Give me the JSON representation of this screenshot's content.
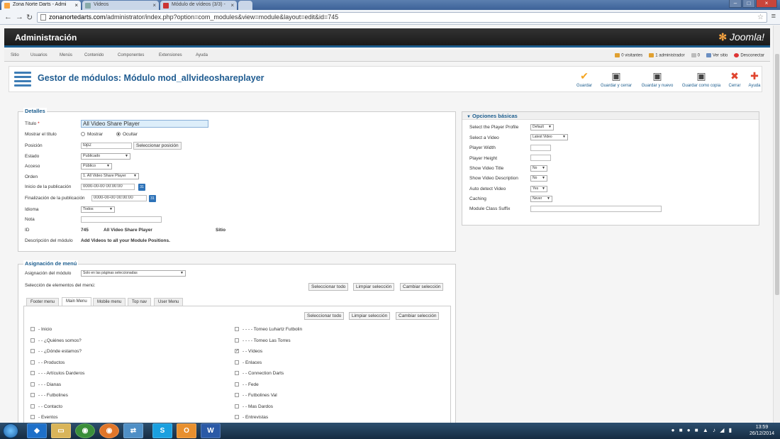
{
  "browser": {
    "tabs": [
      {
        "label": "Zona Norte Darts - Admi",
        "active": true
      },
      {
        "label": "Videos",
        "active": false
      },
      {
        "label": "Módulo de vídeos (3/3) - ",
        "active": false
      }
    ],
    "url_host": "zonanortedarts.com",
    "url_path": "/administrator/index.php?option=com_modules&view=module&layout=edit&id=745"
  },
  "header": {
    "title": "Administración",
    "logo": "Joomla!"
  },
  "topnav": {
    "items": [
      "Sitio",
      "Usuarios",
      "Menús",
      "Contenido",
      "Componentes",
      "Extensiones",
      "Ayuda"
    ],
    "status": {
      "visitors": "0 visitantes",
      "admins": "1 administrador",
      "messages": "0",
      "view_site": "Ver sitio",
      "logout": "Desconectar"
    }
  },
  "toolbar": {
    "title": "Gestor de módulos: Módulo mod_allvideoshareplayer",
    "buttons": [
      "Guardar",
      "Guardar y cerrar",
      "Guardar y nuevo",
      "Guardar como copia",
      "Cerrar",
      "Ayuda"
    ]
  },
  "details": {
    "legend": "Detalles",
    "title_label": "Título",
    "title_value": "All Video Share Player",
    "show_title_label": "Mostrar el título",
    "show_option": "Mostrar",
    "hide_option": "Ocultar",
    "position_label": "Posición",
    "position_value": "top2",
    "position_button": "Seleccionar posición",
    "state_label": "Estado",
    "state_value": "Publicado",
    "access_label": "Acceso",
    "access_value": "Público",
    "order_label": "Orden",
    "order_value": "1. All Video Share Player",
    "publish_up_label": "Inicio de la publicación",
    "publish_up_value": "0000-00-00 00:00:00",
    "publish_down_label": "Finalización de la publicación",
    "publish_down_value": "0000-00-00 00:00:00",
    "language_label": "Idioma",
    "language_value": "Todos",
    "note_label": "Nota",
    "note_value": "",
    "id_label": "ID",
    "id_value": "745",
    "module_name": "All Video Share Player",
    "client": "Sitio",
    "desc_label": "Descripción del módulo",
    "desc_value": "Add Videos to all your Module Positions."
  },
  "basic": {
    "legend": "Opciones básicas",
    "rows": [
      {
        "label": "Select the Player Profile",
        "value": "Default"
      },
      {
        "label": "Select a Video",
        "value": "Latest Video"
      },
      {
        "label": "Player Width",
        "value": ""
      },
      {
        "label": "Player Height",
        "value": ""
      },
      {
        "label": "Show Video Title",
        "value": "No"
      },
      {
        "label": "Show Video Description",
        "value": "No"
      },
      {
        "label": "Auto detect Video",
        "value": "Yes"
      },
      {
        "label": "Caching",
        "value": "Never"
      },
      {
        "label": "Module Class Suffix",
        "value": ""
      }
    ]
  },
  "menu_assignment": {
    "legend": "Asignación de menú",
    "assign_label": "Asignación del módulo",
    "assign_value": "Solo en las páginas seleccionadas",
    "selection_label": "Selección de elementos del menú:",
    "select_all": "Seleccionar todo",
    "clear": "Limpiar selección",
    "toggle": "Cambiar selección",
    "tabs": [
      "Footer menu",
      "Main Menu",
      "Mobile menu",
      "Top nav",
      "User Menu"
    ],
    "left_items": [
      {
        "label": "- Inicio",
        "checked": false
      },
      {
        "label": "- - ¿Quiénes somos?",
        "checked": false
      },
      {
        "label": "- - ¿Dónde estamos?",
        "checked": false
      },
      {
        "label": "- - Productos",
        "checked": false
      },
      {
        "label": "- - - Artículos Darderos",
        "checked": false
      },
      {
        "label": "- - - Dianas",
        "checked": false
      },
      {
        "label": "- - - Futbolines",
        "checked": false
      },
      {
        "label": "- - Contacto",
        "checked": false
      },
      {
        "label": "- Eventos",
        "checked": false
      }
    ],
    "right_items": [
      {
        "label": "- - - - Torneo Luhartz Futbolin",
        "checked": false
      },
      {
        "label": "- - - - Torneo Las Torres",
        "checked": false
      },
      {
        "label": "- - Vídeos",
        "checked": true
      },
      {
        "label": "- Enlaces",
        "checked": false
      },
      {
        "label": "- - Connection Darts",
        "checked": false
      },
      {
        "label": "- - Fede",
        "checked": false
      },
      {
        "label": "- - Futbolines Val",
        "checked": false
      },
      {
        "label": "- - Mas Dardos",
        "checked": false
      },
      {
        "label": "- Entrevistas",
        "checked": false
      }
    ]
  },
  "taskbar": {
    "time": "13:59",
    "date": "26/12/2014"
  }
}
